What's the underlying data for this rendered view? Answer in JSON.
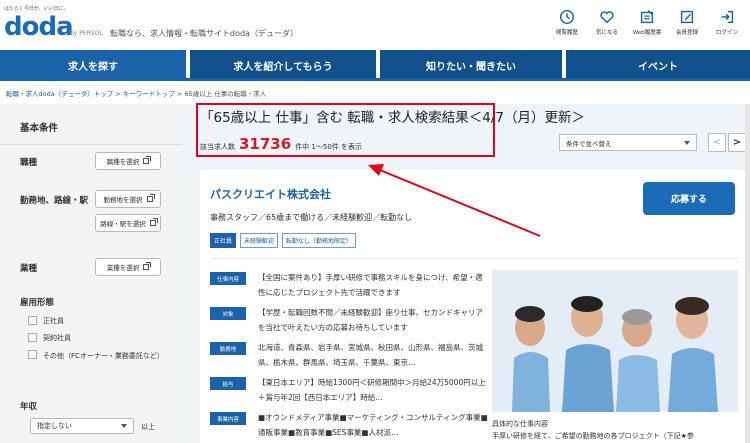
{
  "header": {
    "tagline": "はたらく今日が、いい日に。",
    "logo": "doda",
    "logo_by": "by PERSOL",
    "site_desc": "転職なら、求人情報・転職サイトdoda（デューダ）",
    "nav": [
      {
        "label": "閲覧履歴",
        "icon": "history-icon"
      },
      {
        "label": "気になる",
        "icon": "heart-icon"
      },
      {
        "label": "Web履歴書",
        "icon": "resume-icon"
      },
      {
        "label": "会員登録",
        "icon": "register-icon"
      },
      {
        "label": "ログイン",
        "icon": "login-icon"
      }
    ]
  },
  "tabs": [
    "求人を探す",
    "求人を紹介してもらう",
    "知りたい・聞きたい",
    "イベント"
  ],
  "breadcrumb": {
    "items": [
      "転職・求人doda（デューダ）トップ",
      "キーワードトップ"
    ],
    "current": "65歳以上 仕事の転職・求人",
    "sep": ">"
  },
  "sidebar": {
    "title": "基本条件",
    "job_type": {
      "label": "職種",
      "button": "職種を選択"
    },
    "location": {
      "label": "勤務地、路線・駅",
      "button1": "勤務地を選択",
      "button2": "路線・駅を選択"
    },
    "industry": {
      "label": "業種",
      "button": "業種を選択"
    },
    "employment": {
      "label": "雇用形態",
      "options": [
        "正社員",
        "契約社員",
        "その他（FCオーナー・業務委託など）"
      ]
    },
    "salary": {
      "label": "年収",
      "select": "指定しない",
      "suffix": "以上"
    }
  },
  "results": {
    "title": "「65歳以上 仕事」含む 転職・求人検索結果＜4/7（月）更新＞",
    "count_prefix": "該当求人数",
    "count": "31736",
    "count_suffix": "件中 1～50件 を表示",
    "sort": "条件で並べ替え",
    "prev": "<",
    "next": ">"
  },
  "job": {
    "company": "パスクリエイト株式会社",
    "title": "事務スタッフ／65歳まで働ける／未経験歓迎／転勤なし",
    "tags": [
      "正社員",
      "未経験歓迎",
      "転勤なし（勤務地限定）"
    ],
    "apply": "応募する",
    "details": [
      {
        "label": "仕事内容",
        "text": "【全国に案件あり】手厚い研修で事務スキルを身につけ、希望・適性に応じたプロジェクト先で活躍できます"
      },
      {
        "label": "対象",
        "text": "【学歴・転職回数不問／未経験歓迎】座り仕事、セカンドキャリアを当社で叶えたい方の応募お待ちしています"
      },
      {
        "label": "勤務地",
        "text": "北海道、青森県、岩手県、宮城県、秋田県、山形県、福島県、茨城県、栃木県、群馬県、埼玉県、千葉県、東京…"
      },
      {
        "label": "給与",
        "text": "【東日本エリア】時給1300円＜研修期間中＞月給24万5000円以上＋賞与年2回【西日本エリア】時給…"
      },
      {
        "label": "事業内容",
        "text": "■オウンドメディア事業■マーケティング・コンサルティング事業■通販事業■教育事業■SES事業■人材派…"
      }
    ],
    "photo_caption_title": "具体的な仕事内容",
    "photo_caption_text": "手厚い研修を経て、ご希望の勤務地の各プロジェクト（下記★参"
  },
  "colors": {
    "brand": "#1a63a8",
    "highlight": "#d11b2a",
    "annotation": "#e3001b"
  }
}
